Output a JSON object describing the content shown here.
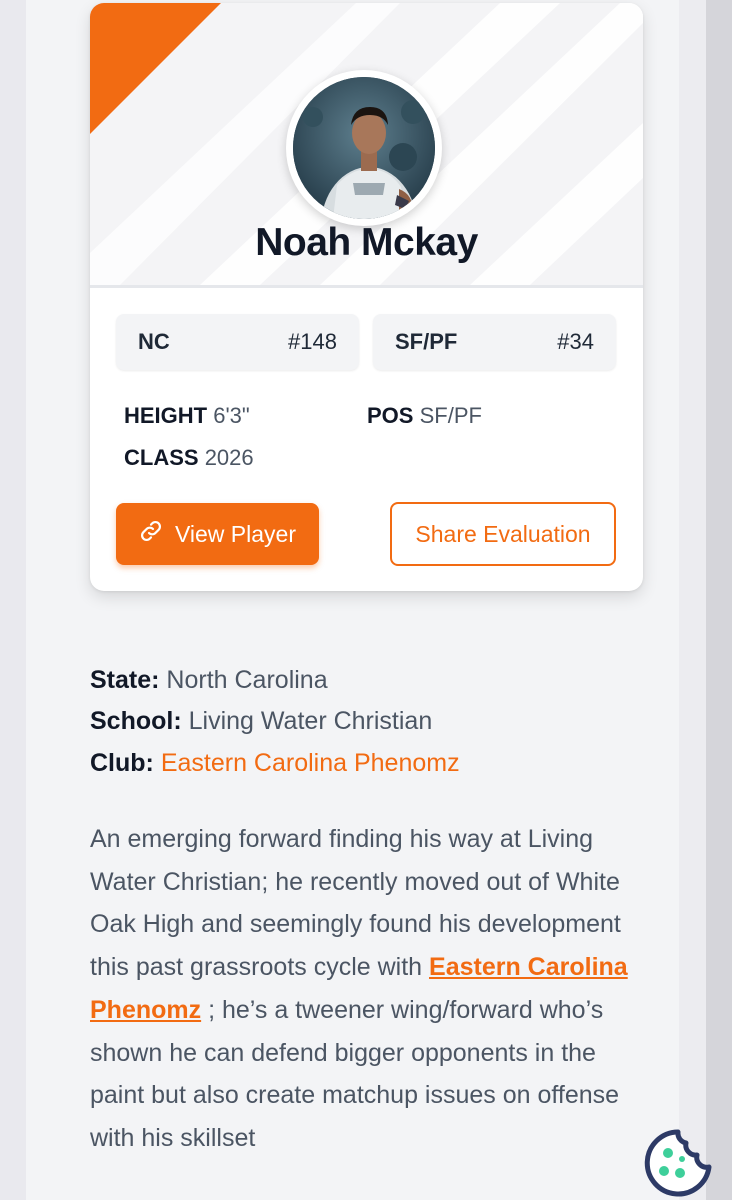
{
  "player": {
    "name": "Noah Mckay",
    "avatar_icon": "player-photo"
  },
  "chips": {
    "state_code": "NC",
    "state_rank": "#148",
    "position": "SF/PF",
    "position_rank": "#34"
  },
  "attributes": {
    "height_label": "HEIGHT",
    "height_value": "6'3\"",
    "pos_label": "POS",
    "pos_value": "SF/PF",
    "class_label": "CLASS",
    "class_value": "2026"
  },
  "buttons": {
    "view_player": "View Player",
    "share_evaluation": "Share Evaluation"
  },
  "details": {
    "state_label": "State:",
    "state_value": "North Carolina",
    "school_label": "School:",
    "school_value": "Living Water Christian",
    "club_label": "Club:",
    "club_value": "Eastern Carolina Phenomz"
  },
  "bio": {
    "part1": "An emerging forward finding his way at Living Water Christian; he recently moved out of White Oak High and seemingly found his development this past grassroots cycle with ",
    "link": "Eastern Carolina Phenomz",
    "part2": " ; he’s a tweener wing/forward who’s shown he can defend bigger opponents in the paint but also create matchup issues on offense with his skillset"
  },
  "colors": {
    "accent": "#f26b12",
    "cookie": "#2d3a66",
    "cookie_dots": "#3ecf9a"
  },
  "icons": {
    "link": "link-icon",
    "cookie": "cookie-icon"
  }
}
